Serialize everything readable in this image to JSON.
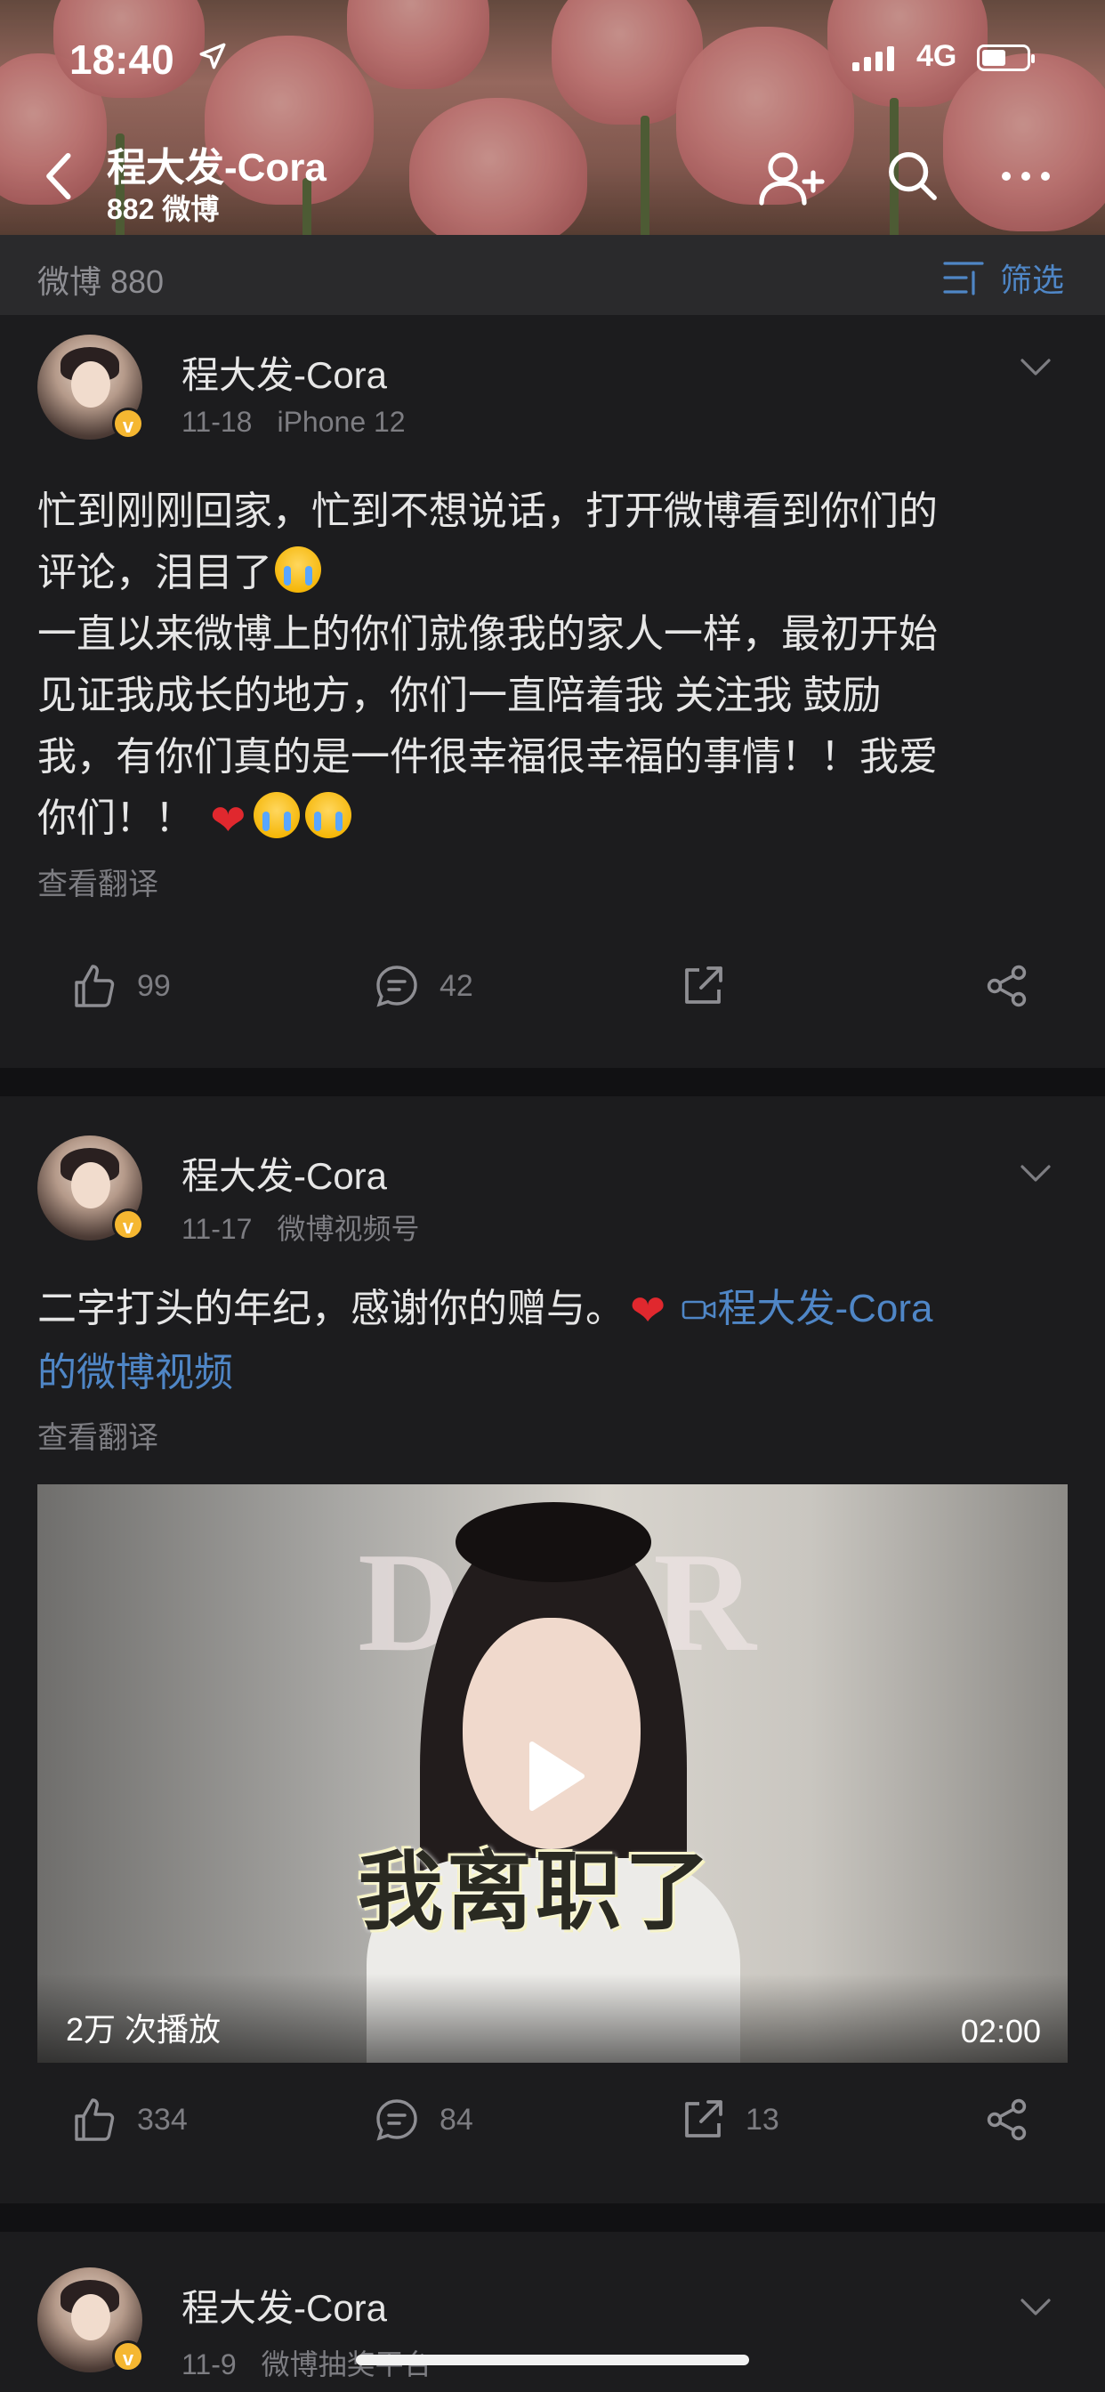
{
  "status_bar": {
    "time": "18:40",
    "network": "4G"
  },
  "header": {
    "name": "程大发-Cora",
    "post_count": "882 微博"
  },
  "filter_bar": {
    "count_label": "微博 880",
    "filter_label": "筛选"
  },
  "posts": [
    {
      "author": "程大发-Cora",
      "date": "11-18",
      "source": "iPhone 12",
      "lines": [
        "忙到刚刚回家，忙到不想说话，打开微博看到你们的",
        "评论，泪目了",
        "一直以来微博上的你们就像我的家人一样，最初开始",
        "见证我成长的地方，你们一直陪着我 关注我 鼓励",
        "我，有你们真的是一件很幸福很幸福的事情！！我爱",
        "你们！！"
      ],
      "translate": "查看翻译",
      "likes": "99",
      "comments": "42",
      "reposts": ""
    },
    {
      "author": "程大发-Cora",
      "date": "11-17",
      "source": "微博视频号",
      "text": "二字打头的年纪，感谢你的赠与。",
      "link_text_1": "程大发-Cora",
      "link_text_2": "的微博视频",
      "translate": "查看翻译",
      "video": {
        "caption": "我离职了",
        "bg_text": "DIOR",
        "plays": "2万 次播放",
        "duration": "02:00"
      },
      "likes": "334",
      "comments": "84",
      "reposts": "13"
    },
    {
      "author": "程大发-Cora",
      "date": "11-9",
      "source": "微博抽奖平台"
    }
  ],
  "colors": {
    "background": "#1c1c1e",
    "link": "#4f86c6",
    "muted": "#7d7d82",
    "verified_badge": "#f5b731",
    "heart": "#e0282e"
  }
}
